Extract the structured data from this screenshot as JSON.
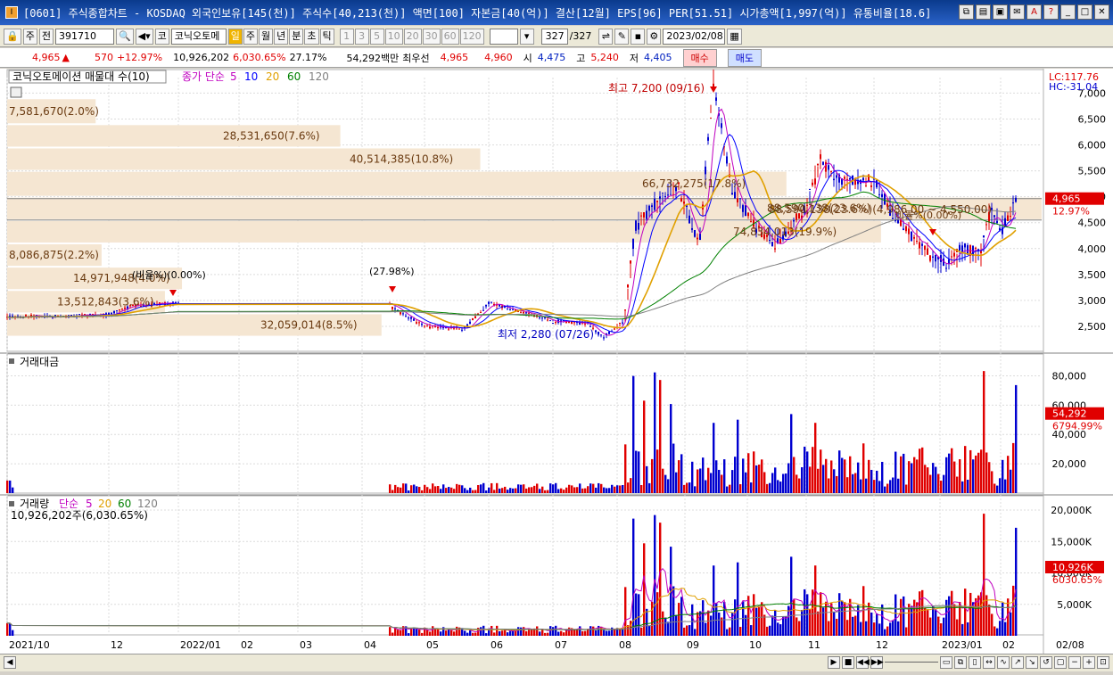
{
  "window": {
    "title": "[0601] 주식종합차트 - KOSDAQ 외국인보유[145(천)] 주식수[40,213(천)] 액면[100] 자본금[40(억)] 결산[12월] EPS[96] PER[51.51] 시가총액[1,997(억)] 유통비율[18.6]",
    "icon_label": "I"
  },
  "toolbar": {
    "mode": "주",
    "prev_label": "전",
    "code": "391710",
    "market": "코",
    "name": "코닉오토메",
    "periods": [
      "일",
      "주",
      "월",
      "년",
      "분",
      "초",
      "틱"
    ],
    "selected_period": "일",
    "intervals": [
      "1",
      "3",
      "5",
      "10",
      "20",
      "30",
      "60",
      "120"
    ],
    "count": "327",
    "count_total": "/327",
    "date": "2023/02/08"
  },
  "quote": {
    "price": "4,965",
    "arrow": "▲",
    "change": "570",
    "change_pct": "+12.97%",
    "volume": "10,926,202",
    "vol_ratio": "6,030.65%",
    "turnover": "27.17%",
    "amount": "54,292백만",
    "best_label": "최우선",
    "ask": "4,965",
    "bid": "4,960",
    "open_label": "시",
    "open": "4,475",
    "high_label": "고",
    "high": "5,240",
    "low_label": "저",
    "low": "4,405",
    "buy_label": "매수",
    "sell_label": "매도"
  },
  "chart_data": [
    {
      "type": "candlestick",
      "title": "코닉오토메이션 매물대 수(10)",
      "ma_label": "종가 단순",
      "ma_periods": [
        "5",
        "10",
        "20",
        "60",
        "120"
      ],
      "ma_colors": [
        "#c000c0",
        "#0000ff",
        "#e0a000",
        "#008000",
        "#808080"
      ],
      "y_ticks": [
        "7,000",
        "6,500",
        "6,000",
        "5,500",
        "5,000",
        "4,500",
        "4,000",
        "3,500",
        "3,000",
        "2,500"
      ],
      "y_tick_values": [
        7000,
        6500,
        6000,
        5500,
        5000,
        4500,
        4000,
        3500,
        3000,
        2500
      ],
      "ylim": [
        2000,
        7300
      ],
      "x_ticks": [
        "2021/10",
        "12",
        "2022/01",
        "02",
        "03",
        "04",
        "05",
        "06",
        "07",
        "08",
        "09",
        "10",
        "11",
        "12",
        "2023/01",
        "02",
        "02/08"
      ],
      "lc": "LC:117.76",
      "hc": "HC:-31.04",
      "price_tag": "4,965",
      "pct_tag": "12.97%",
      "high_annot": "최고 7,200 (09/16)",
      "low_annot": "최저 2,280 (07/26)",
      "pct_annot": "(27.98%)",
      "break_annot_1": "(비율%)(0.00%)",
      "break_annot_2": "비율%(0.00%)",
      "range_annot": "88,590,138(23.6%)(4,986.00 ~ 4,550.00)",
      "volume_profile": [
        {
          "label": "7,581,670(2.0%)",
          "value": 7581670,
          "price_lo": 6400,
          "price_hi": 6900
        },
        {
          "label": "28,531,650(7.6%)",
          "value": 28531650,
          "price_lo": 5950,
          "price_hi": 6400
        },
        {
          "label": "40,514,385(10.8%)",
          "value": 40514385,
          "price_lo": 5500,
          "price_hi": 5950
        },
        {
          "label": "66,732,275(17.8%)",
          "value": 66732275,
          "price_lo": 5000,
          "price_hi": 5500
        },
        {
          "label": "88,590,138(23.6%)",
          "value": 88590138,
          "price_lo": 4550,
          "price_hi": 5000
        },
        {
          "label": "74,834,013(19.9%)",
          "value": 74834013,
          "price_lo": 4100,
          "price_hi": 4550
        },
        {
          "label": "8,086,875(2.2%)",
          "value": 8086875,
          "price_lo": 3650,
          "price_hi": 4100
        },
        {
          "label": "14,971,948(4.0%)",
          "value": 14971948,
          "price_lo": 3200,
          "price_hi": 3650
        },
        {
          "label": "13,512,843(3.6%)",
          "value": 13512843,
          "price_lo": 2750,
          "price_hi": 3200
        },
        {
          "label": "32,059,014(8.5%)",
          "value": 32059014,
          "price_lo": 2300,
          "price_hi": 2750
        }
      ]
    },
    {
      "type": "bar",
      "title": "거래대금",
      "y_ticks": [
        "80,000",
        "60,000",
        "40,000",
        "20,000"
      ],
      "y_tick_values": [
        80000,
        60000,
        40000,
        20000
      ],
      "ylim": [
        0,
        90000
      ],
      "last_tag": "54,292",
      "last_pct": "6794.99%"
    },
    {
      "type": "bar",
      "title": "거래량",
      "ma_label": "단순",
      "ma_periods": [
        "5",
        "20",
        "60",
        "120"
      ],
      "ma_colors": [
        "#c000c0",
        "#e0a000",
        "#008000",
        "#808080"
      ],
      "subtitle": "10,926,202주(6,030.65%)",
      "y_ticks": [
        "20,000K",
        "15,000K",
        "10,000K",
        "5,000K"
      ],
      "y_tick_values": [
        20000,
        15000,
        10000,
        5000
      ],
      "ylim": [
        0,
        21000
      ],
      "last_tag": "10,926K",
      "last_pct": "6030.65%"
    }
  ]
}
